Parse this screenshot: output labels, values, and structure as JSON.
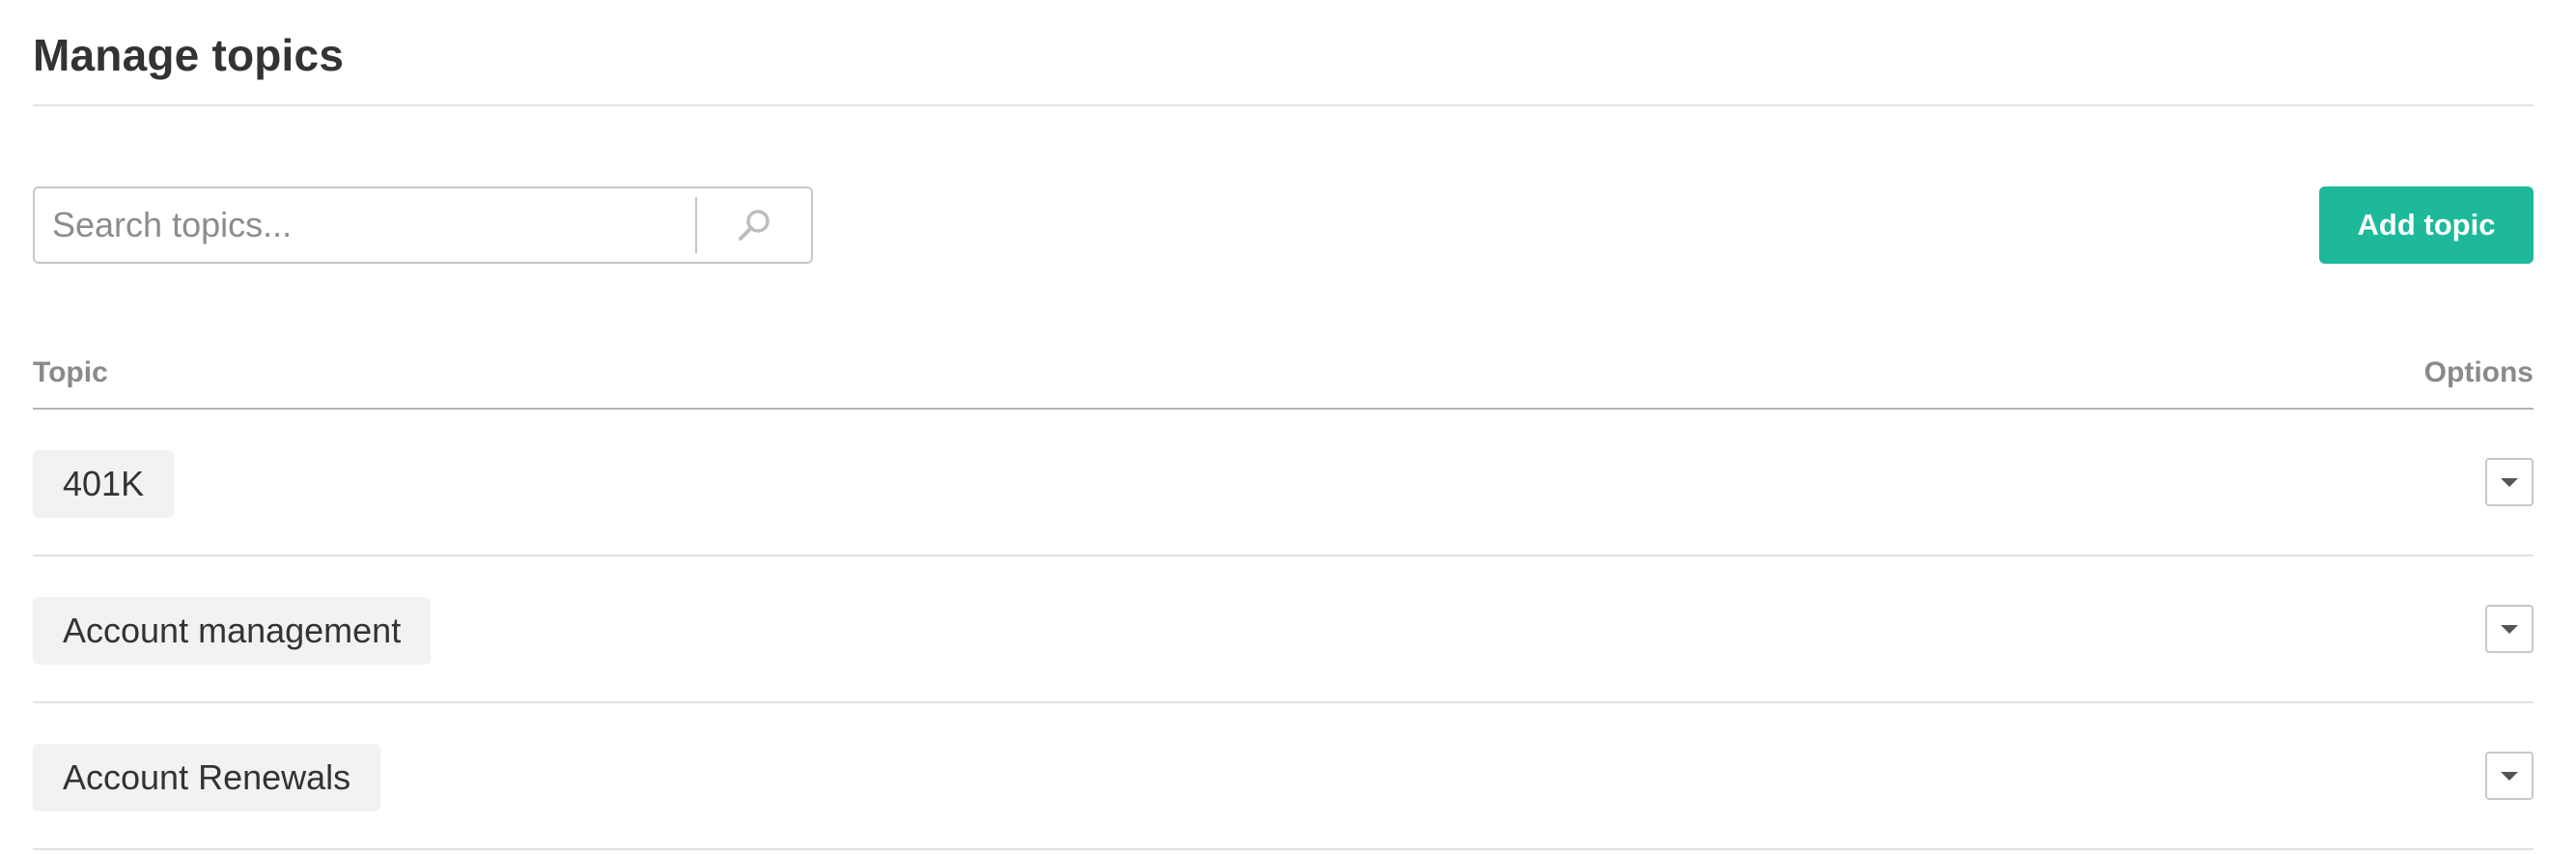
{
  "page": {
    "title": "Manage topics"
  },
  "toolbar": {
    "search_placeholder": "Search topics...",
    "search_value": "",
    "add_label": "Add topic",
    "accent_color": "#1db99a"
  },
  "table": {
    "columns": {
      "topic": "Topic",
      "options": "Options"
    },
    "rows": [
      {
        "topic": "401K"
      },
      {
        "topic": "Account management"
      },
      {
        "topic": "Account Renewals"
      }
    ]
  },
  "icons": {
    "search": "search-icon",
    "dropdown": "chevron-down-icon"
  }
}
